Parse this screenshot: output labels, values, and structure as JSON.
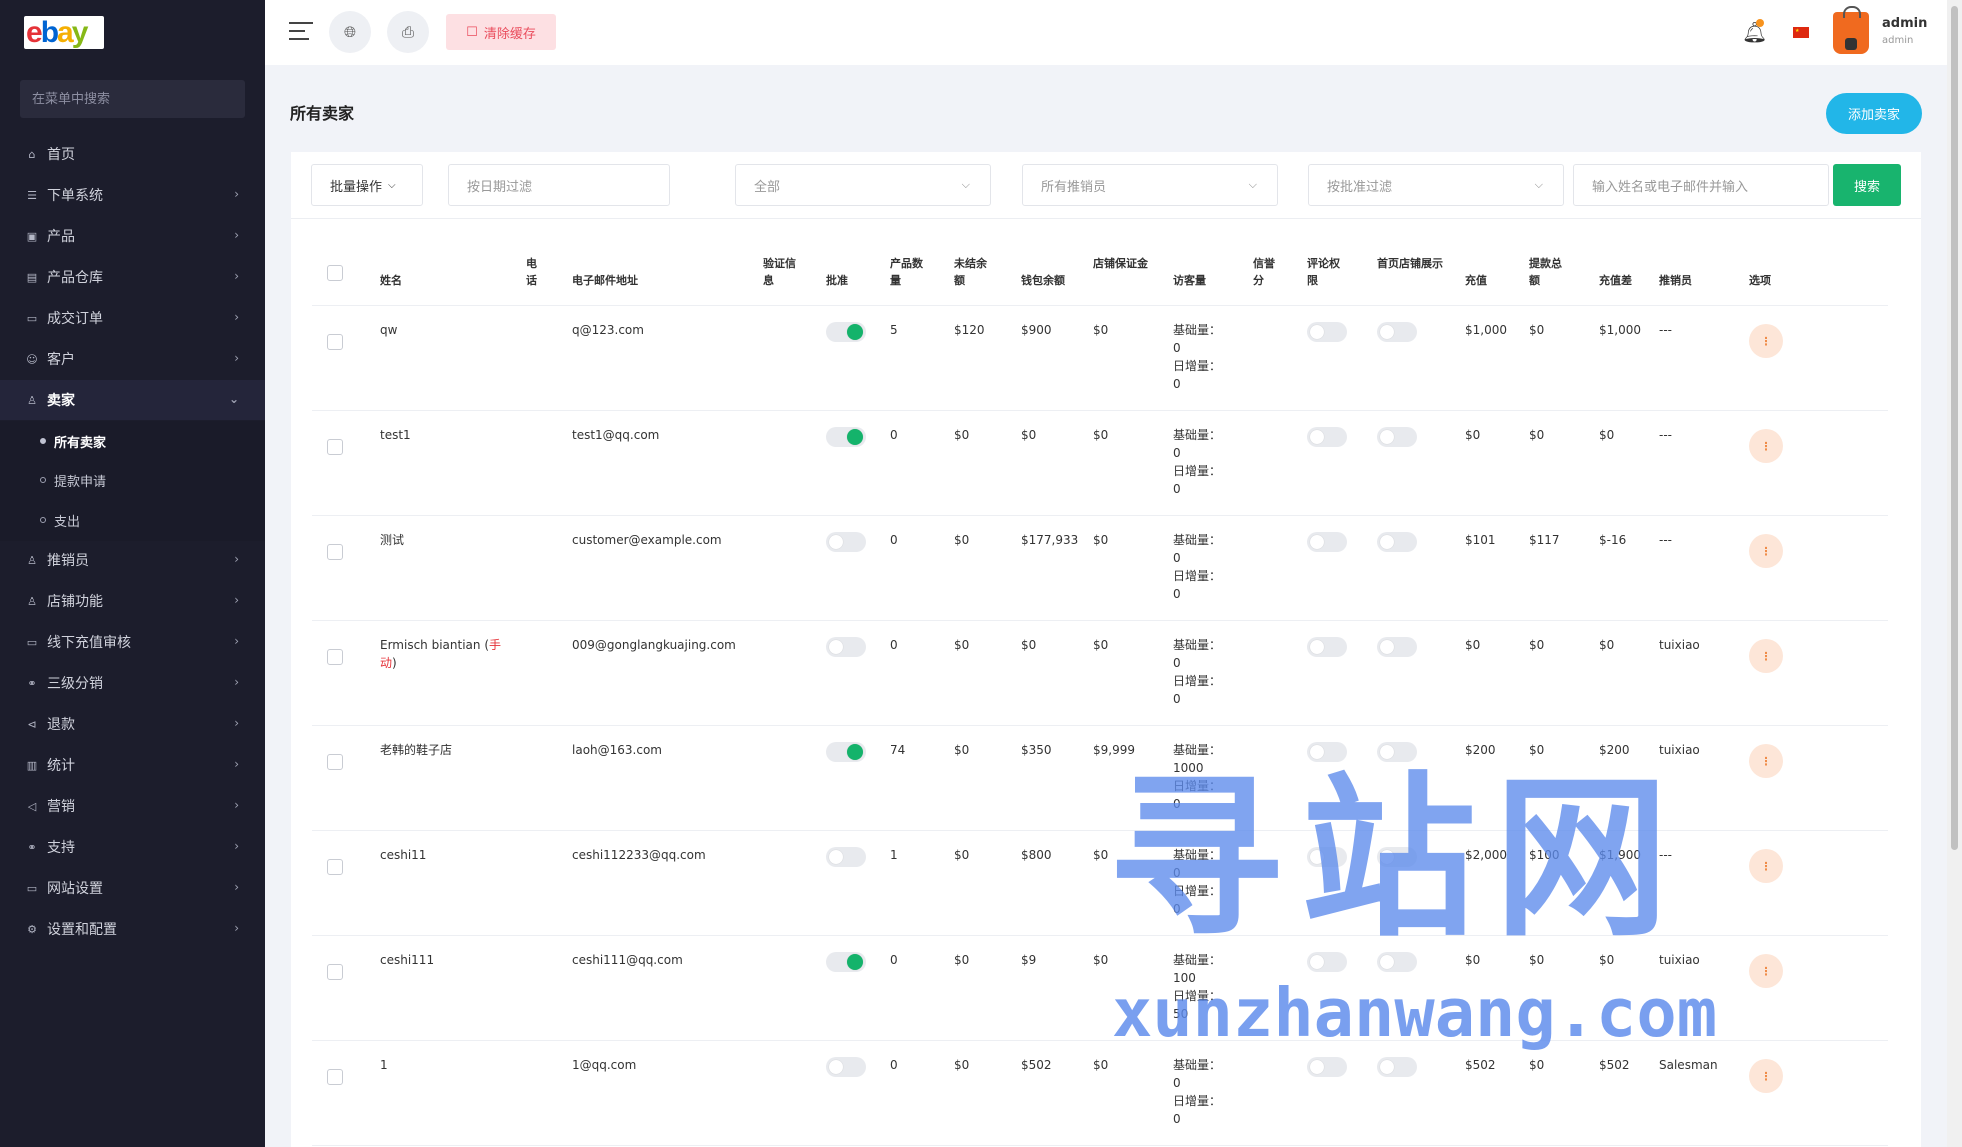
{
  "sidebar": {
    "logo_letters": [
      "e",
      "b",
      "a",
      "y"
    ],
    "search_placeholder": "在菜单中搜索",
    "items": [
      {
        "label": "首页",
        "icon": "⌂",
        "chev": false
      },
      {
        "label": "下单系统",
        "icon": "☰",
        "chev": true
      },
      {
        "label": "产品",
        "icon": "▣",
        "chev": true
      },
      {
        "label": "产品仓库",
        "icon": "▤",
        "chev": true
      },
      {
        "label": "成交订单",
        "icon": "▭",
        "chev": true
      },
      {
        "label": "客户",
        "icon": "☺",
        "chev": true
      },
      {
        "label": "卖家",
        "icon": "♙",
        "chev": true
      },
      {
        "label": "推销员",
        "icon": "♙",
        "chev": true
      },
      {
        "label": "店铺功能",
        "icon": "♙",
        "chev": true
      },
      {
        "label": "线下充值审核",
        "icon": "▭",
        "chev": true
      },
      {
        "label": "三级分销",
        "icon": "⚭",
        "chev": true
      },
      {
        "label": "退款",
        "icon": "⊲",
        "chev": true
      },
      {
        "label": "统计",
        "icon": "▥",
        "chev": true
      },
      {
        "label": "营销",
        "icon": "◁",
        "chev": true
      },
      {
        "label": "支持",
        "icon": "⚭",
        "chev": true
      },
      {
        "label": "网站设置",
        "icon": "▭",
        "chev": true
      },
      {
        "label": "设置和配置",
        "icon": "⚙",
        "chev": true
      }
    ],
    "subitems": [
      "所有卖家",
      "提款申请",
      "支出"
    ]
  },
  "header": {
    "clear_cache": "清除缓存",
    "user_name": "admin",
    "user_role": "admin"
  },
  "page": {
    "title": "所有卖家",
    "add_button": "添加卖家"
  },
  "filters": {
    "bulk": "批量操作",
    "date_placeholder": "按日期过滤",
    "all": "全部",
    "salesman": "所有推销员",
    "approval": "按批准过滤",
    "search_placeholder": "输入姓名或电子邮件并输入",
    "search_button": "搜索"
  },
  "table": {
    "headers": {
      "name": "姓名",
      "phone": "电话",
      "email": "电子邮件地址",
      "verify": "验证信息",
      "approve": "批准",
      "products": "产品数量",
      "unsettled": "未结余额",
      "wallet": "钱包余额",
      "deposit": "店铺保证金",
      "visits": "访客量",
      "credit": "信誉分",
      "comment": "评论权限",
      "home": "首页店铺展示",
      "recharge": "充值",
      "withdraw": "提款总额",
      "diff": "充值差",
      "salesman": "推销员",
      "options": "选项"
    },
    "visit_labels": {
      "base": "基础量：",
      "daily": "日增量："
    },
    "rows": [
      {
        "name": "qw",
        "email": "q@123.com",
        "approved": true,
        "products": "5",
        "unsettled": "$120",
        "wallet": "$900",
        "deposit": "$0",
        "base": "0",
        "daily": "0",
        "recharge": "$1,000",
        "withdraw": "$0",
        "diff": "$1,000",
        "salesman": "---"
      },
      {
        "name": "test1",
        "email": "test1@qq.com",
        "approved": true,
        "products": "0",
        "unsettled": "$0",
        "wallet": "$0",
        "deposit": "$0",
        "base": "0",
        "daily": "0",
        "recharge": "$0",
        "withdraw": "$0",
        "diff": "$0",
        "salesman": "---"
      },
      {
        "name": "测试",
        "email": "customer@example.com",
        "approved": false,
        "products": "0",
        "unsettled": "$0",
        "wallet": "$177,933",
        "deposit": "$0",
        "base": "0",
        "daily": "0",
        "recharge": "$101",
        "withdraw": "$117",
        "diff": "$-16",
        "salesman": "---"
      },
      {
        "name": "Ermisch biantian (",
        "name_mark": "手动",
        "name_tail": ")",
        "email": "009@gonglangkuajing.com",
        "approved": false,
        "products": "0",
        "unsettled": "$0",
        "wallet": "$0",
        "deposit": "$0",
        "base": "0",
        "daily": "0",
        "recharge": "$0",
        "withdraw": "$0",
        "diff": "$0",
        "salesman": "tuixiao"
      },
      {
        "name": "老韩的鞋子店",
        "email": "laoh@163.com",
        "approved": true,
        "products": "74",
        "unsettled": "$0",
        "wallet": "$350",
        "deposit": "$9,999",
        "base": "1000",
        "daily": "0",
        "recharge": "$200",
        "withdraw": "$0",
        "diff": "$200",
        "salesman": "tuixiao"
      },
      {
        "name": "ceshi11",
        "email": "ceshi112233@qq.com",
        "approved": false,
        "products": "1",
        "unsettled": "$0",
        "wallet": "$800",
        "deposit": "$0",
        "base": "0",
        "daily": "0",
        "recharge": "$2,000",
        "withdraw": "$100",
        "diff": "$1,900",
        "salesman": "---"
      },
      {
        "name": "ceshi111",
        "email": "ceshi111@qq.com",
        "approved": true,
        "products": "0",
        "unsettled": "$0",
        "wallet": "$9",
        "deposit": "$0",
        "base": "100",
        "daily": "50",
        "recharge": "$0",
        "withdraw": "$0",
        "diff": "$0",
        "salesman": "tuixiao"
      },
      {
        "name": "1",
        "email": "1@qq.com",
        "approved": false,
        "products": "0",
        "unsettled": "$0",
        "wallet": "$502",
        "deposit": "$0",
        "base": "0",
        "daily": "0",
        "recharge": "$502",
        "withdraw": "$0",
        "diff": "$502",
        "salesman": "Salesman"
      }
    ]
  },
  "watermark": {
    "cn": "寻站网",
    "en": "xunzhanwang.com"
  },
  "colors": {
    "sidebar": "#1c1d2c",
    "accent_blue": "#22b6e8",
    "accent_green": "#18b46e",
    "clear_cache_bg": "#fde0e3"
  }
}
